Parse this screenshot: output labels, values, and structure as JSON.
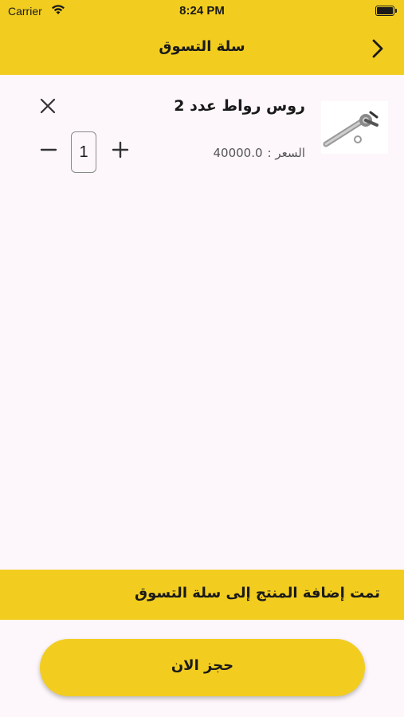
{
  "status_bar": {
    "carrier": "Carrier",
    "time": "8:24 PM"
  },
  "header": {
    "title": "سلة التسوق",
    "back_icon": "chevron-right-icon"
  },
  "cart": {
    "items": [
      {
        "name": "روس رواط عدد 2",
        "price_label": "السعر :",
        "price_value": "40000.0",
        "quantity": "1"
      }
    ]
  },
  "snackbar": {
    "message": "تمت إضافة المنتج إلى سلة التسوق"
  },
  "actions": {
    "book_now_label": "حجز الان"
  },
  "colors": {
    "accent": "#f2cd20",
    "background": "#fdf7fb"
  }
}
